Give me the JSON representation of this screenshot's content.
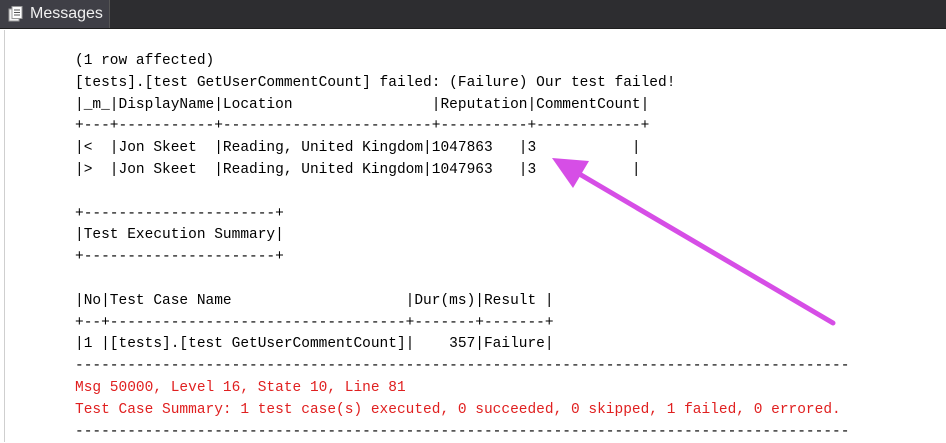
{
  "tab": {
    "title": "Messages",
    "icon": "messages-icon"
  },
  "colors": {
    "error_text": "#e02020",
    "annotation_arrow": "#d64ee6",
    "tab_background": "#3f3f46"
  },
  "output": {
    "lines": [
      {
        "text": "(1 row affected)",
        "error": false
      },
      {
        "text": "[tests].[test GetUserCommentCount] failed: (Failure) Our test failed!",
        "error": false
      },
      {
        "text": "|_m_|DisplayName|Location                |Reputation|CommentCount|",
        "error": false
      },
      {
        "text": "+---+-----------+------------------------+----------+------------+",
        "error": false
      },
      {
        "text": "|<  |Jon Skeet  |Reading, United Kingdom|1047863   |3           |",
        "error": false
      },
      {
        "text": "|>  |Jon Skeet  |Reading, United Kingdom|1047963   |3           |",
        "error": false
      },
      {
        "text": "",
        "error": false
      },
      {
        "text": "+----------------------+",
        "error": false
      },
      {
        "text": "|Test Execution Summary|",
        "error": false
      },
      {
        "text": "+----------------------+",
        "error": false
      },
      {
        "text": "",
        "error": false
      },
      {
        "text": "|No|Test Case Name                    |Dur(ms)|Result |",
        "error": false
      },
      {
        "text": "+--+----------------------------------+-------+-------+",
        "error": false
      },
      {
        "text": "|1 |[tests].[test GetUserCommentCount]|    357|Failure|",
        "error": false
      },
      {
        "text": "-----------------------------------------------------------------------------------------",
        "error": false
      },
      {
        "text": "Msg 50000, Level 16, State 10, Line 81",
        "error": true
      },
      {
        "text": "Test Case Summary: 1 test case(s) executed, 0 succeeded, 0 skipped, 1 failed, 0 errored.",
        "error": true
      },
      {
        "text": "-----------------------------------------------------------------------------------------",
        "error": false
      }
    ]
  }
}
